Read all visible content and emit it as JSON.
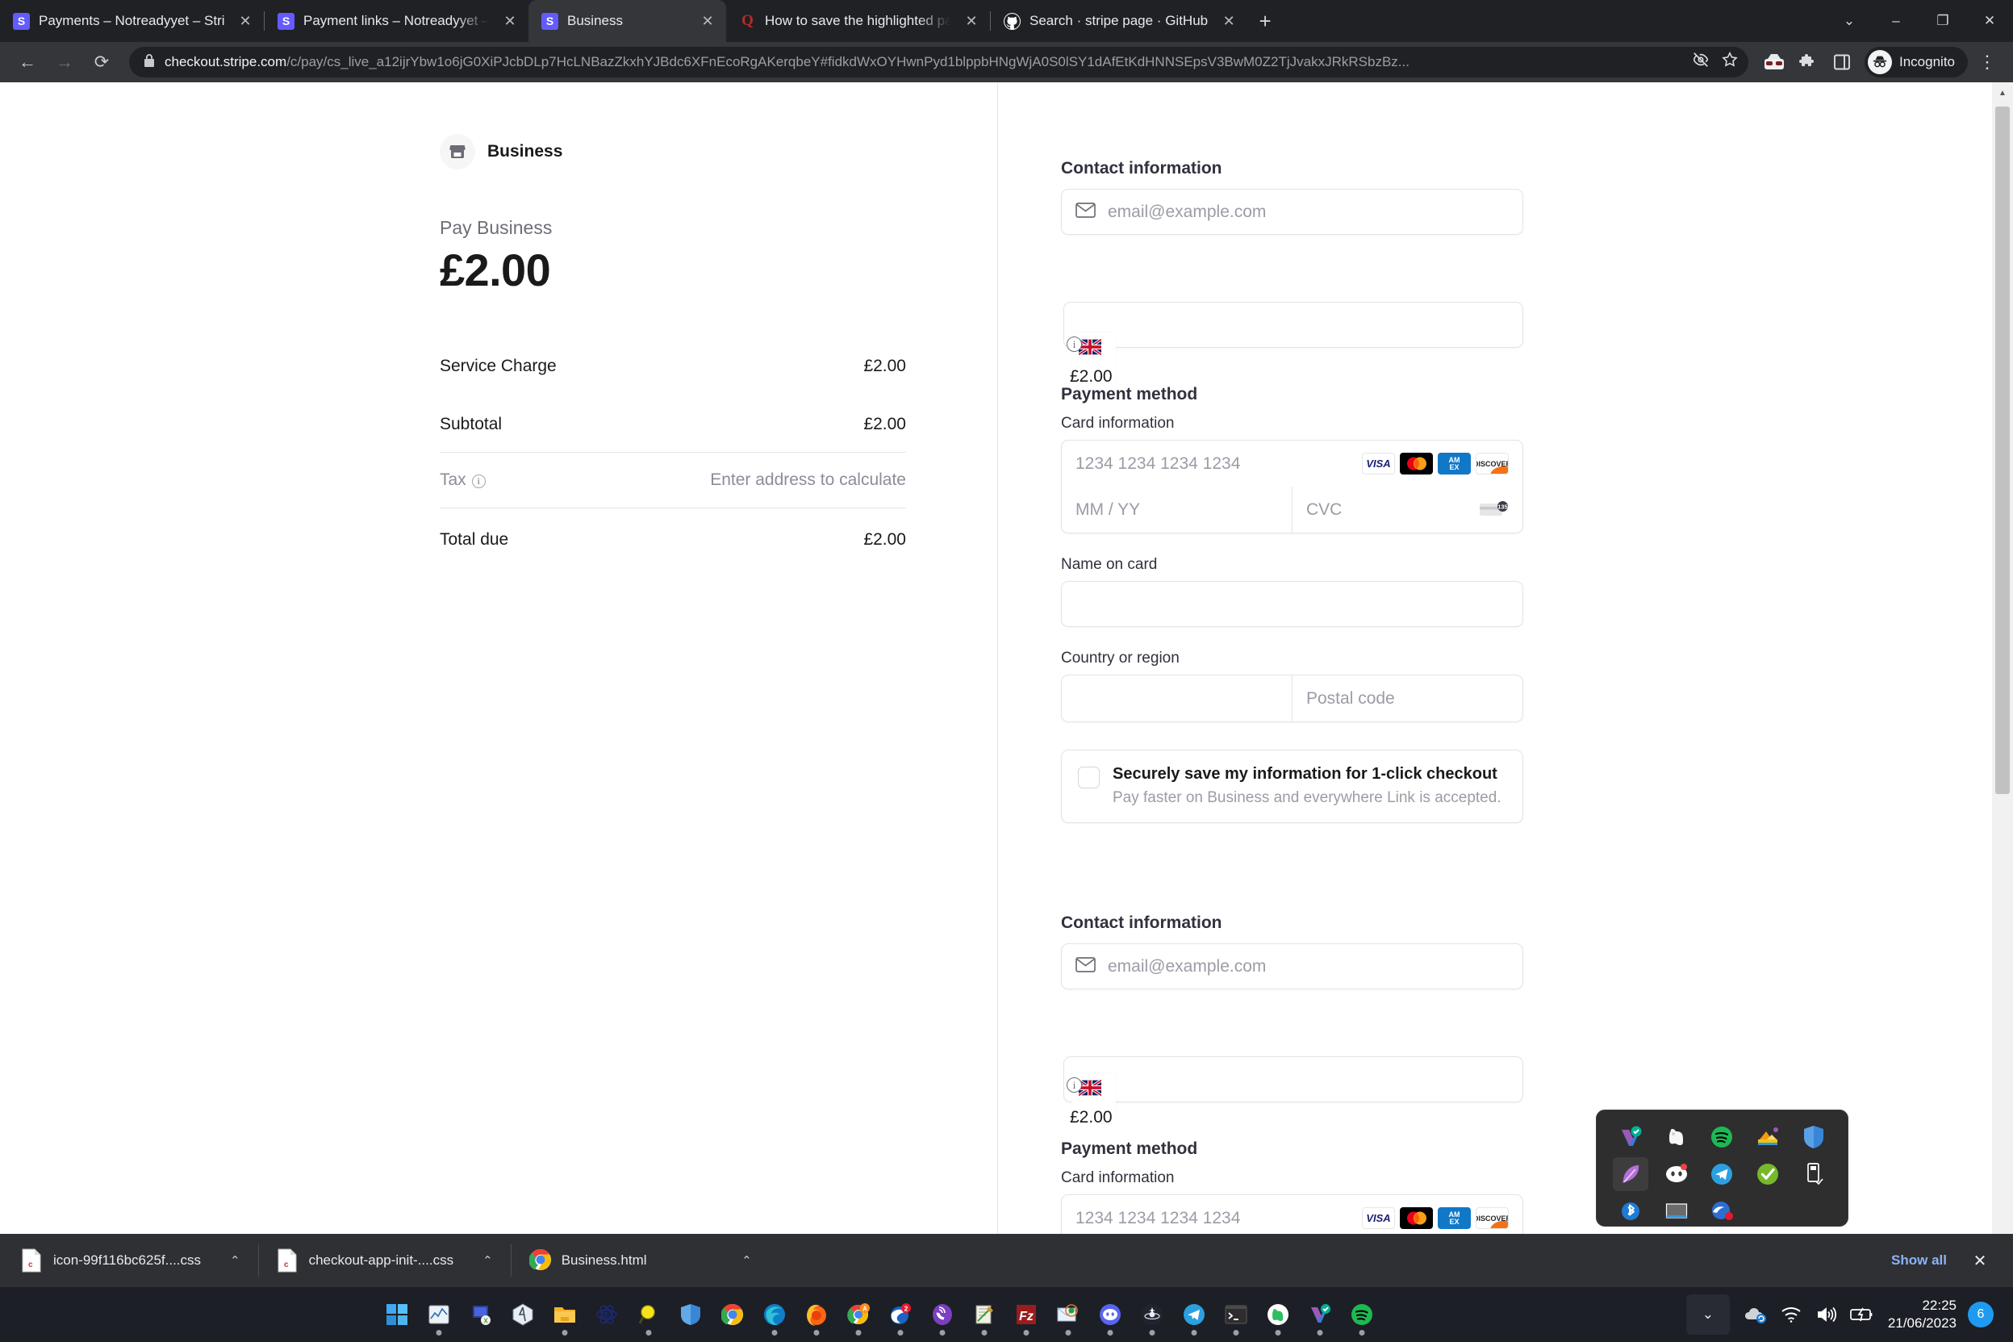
{
  "browser": {
    "tabs": [
      {
        "title": "Payments – Notreadyyet – Stripe",
        "favicon": "stripe-icon",
        "active": false
      },
      {
        "title": "Payment links – Notreadyyet – Stripe",
        "favicon": "stripe-icon",
        "active": false
      },
      {
        "title": "Business",
        "favicon": "stripe-icon",
        "active": true
      },
      {
        "title": "How to save the highlighted part",
        "favicon": "quora-icon",
        "active": false
      },
      {
        "title": "Search · stripe page · GitHub",
        "favicon": "github-icon",
        "active": false
      }
    ],
    "close_label": "✕",
    "new_tab_label": "+",
    "window_controls": {
      "minimize_all": "⌄",
      "minimize": "–",
      "maximize": "❐",
      "close": "✕"
    },
    "nav": {
      "back": "←",
      "forward": "→",
      "reload": "⟳"
    },
    "url": {
      "lock": "lock-icon",
      "host": "checkout.stripe.com",
      "path": "/c/pay/cs_live_a12ijrYbw1o6jG0XiPJcbDLp7HcLNBazZkxhYJBdc6XFnEcoRgAKerqbeY#fidkdWxOYHwnPyd1blppbHNgWjA0S0lSY1dAfEtKdHNNSEpsV3BwM0Z2TjJvakxJRkRSbzBz..."
    },
    "toolbar_icons": [
      "eye-slash-icon",
      "star-icon",
      "incognito-extension-icon",
      "extensions-puzzle-icon",
      "side-panel-icon"
    ],
    "profile": {
      "label": "Incognito",
      "avatar": "incognito-avatar-icon"
    },
    "menu": "⋮"
  },
  "checkout": {
    "merchant": {
      "name": "Business",
      "logo": "storefront-icon"
    },
    "pay_label": "Pay Business",
    "pay_amount": "£2.00",
    "summary_lines": [
      {
        "name": "Service Charge",
        "value": "£2.00",
        "muted": false
      },
      {
        "name": "Subtotal",
        "value": "£2.00",
        "muted": false
      },
      {
        "name": "Tax",
        "value": "Enter address to calculate",
        "muted": true,
        "info": "i"
      },
      {
        "name": "Total due",
        "value": "£2.00",
        "muted": false
      }
    ],
    "form": {
      "contact_title": "Contact information",
      "email_placeholder": "email@example.com",
      "email_icon": "envelope-icon",
      "payment_title": "Payment method",
      "card_info_label": "Card information",
      "card_number_placeholder": "1234 1234 1234 1234",
      "expiry_placeholder": "MM / YY",
      "cvc_placeholder": "CVC",
      "card_brands": [
        "VISA",
        "Mastercard",
        "AMEX",
        "DISCOVER"
      ],
      "name_on_card_label": "Name on card",
      "name_on_card_value": "",
      "country_label": "Country or region",
      "country_value": "",
      "postal_placeholder": "Postal code",
      "save_info_title": "Securely save my information for 1-click checkout",
      "save_info_sub": "Pay faster on Business and everywhere Link is accepted."
    },
    "artifacts": {
      "flag": "uk-flag-icon",
      "info_badge": "i",
      "amount_behind": "£2.00"
    }
  },
  "downloads": {
    "items": [
      {
        "name": "icon-99f116bc625f....css",
        "icon": "css-file-icon",
        "caret": "⌃"
      },
      {
        "name": "checkout-app-init-....css",
        "icon": "css-file-icon",
        "caret": "⌃"
      },
      {
        "name": "Business.html",
        "icon": "chrome-icon",
        "caret": "⌃"
      }
    ],
    "show_all": "Show all",
    "close": "✕"
  },
  "tray_popup": {
    "icons": [
      "veeam-check-icon",
      "evernote-icon",
      "spotify-icon",
      "image-editor-icon",
      "windows-security-icon",
      "feather-editor-icon",
      "discord-icon",
      "telegram-icon",
      "green-check-icon",
      "usb-eject-icon",
      "bluetooth-icon",
      "keyboard-icon",
      "mail-notify-icon"
    ],
    "selected_index": 5
  },
  "taskbar": {
    "apps": [
      "start-icon",
      "task-manager-icon",
      "remote-desktop-icon",
      "yandex-icon",
      "file-explorer-icon",
      "atom-b-icon",
      "search-icon",
      "windows-security-icon",
      "chrome-icon",
      "edge-icon",
      "firefox-icon",
      "chrome-a-icon",
      "thunderbird-icon",
      "viber-icon",
      "notepad-icon",
      "filezilla-icon",
      "mail-atom-icon",
      "discord-icon",
      "genshin-icon",
      "telegram-icon",
      "terminal-icon",
      "evernote-icon",
      "veeam-icon",
      "spotify-icon"
    ],
    "system": {
      "chevron": "⌄",
      "icons": [
        "onedrive-sync-icon",
        "wifi-icon",
        "volume-icon",
        "battery-charging-icon"
      ],
      "time": "22:25",
      "date": "21/06/2023",
      "notification_count": "6"
    }
  },
  "colors": {
    "chrome_dark": "#35363a",
    "tabstrip": "#202124",
    "accent_link": "#8ab4f8",
    "stripe_purple": "#635bff",
    "taskbar": "#1c1f26",
    "badge_blue": "#1e9bf0"
  }
}
